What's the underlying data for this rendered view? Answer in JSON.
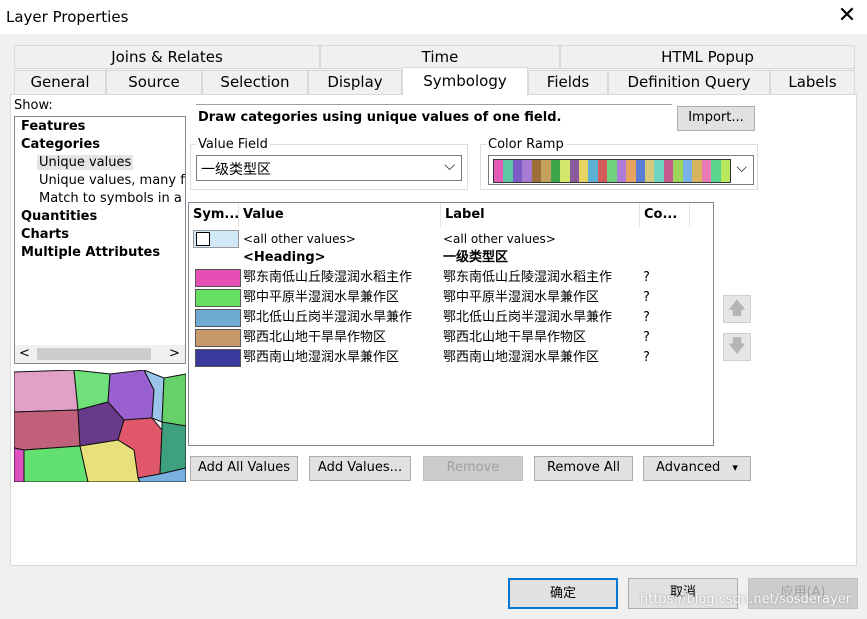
{
  "window": {
    "title": "Layer Properties",
    "close_glyph": "✕"
  },
  "tabs_top": [
    "Joins & Relates",
    "Time",
    "HTML Popup"
  ],
  "tabs_bottom": [
    "General",
    "Source",
    "Selection",
    "Display",
    "Symbology",
    "Fields",
    "Definition Query",
    "Labels"
  ],
  "active_tab": "Symbology",
  "show": {
    "label": "Show:",
    "items": [
      "Features",
      "Categories",
      "Unique values",
      "Unique values, many fiel",
      "Match to symbols in a sty",
      "Quantities",
      "Charts",
      "Multiple Attributes"
    ],
    "selected": "Unique values",
    "scroll_left": "<",
    "scroll_right": ">"
  },
  "symbology": {
    "description": "Draw categories using unique values of one field.",
    "import_label": "Import...",
    "value_field_label": "Value Field",
    "value_field_value": "一级类型区",
    "color_ramp_label": "Color Ramp",
    "color_ramp_colors": [
      "#e45bb8",
      "#5dc7a3",
      "#7c5cc4",
      "#a67bd2",
      "#9e6e3b",
      "#c4a25d",
      "#3fa54a",
      "#d3e76d",
      "#8a5b9c",
      "#e8d361",
      "#5bb0d6",
      "#d65b5b",
      "#72d17c",
      "#b07ad8",
      "#e8a361",
      "#5b7dd6",
      "#d8c97a",
      "#6fd6c4",
      "#c75b8e",
      "#9ed65b",
      "#7ab0e8",
      "#d6b45b",
      "#e87ab8",
      "#5bd68e",
      "#b8e85b"
    ],
    "combo_arrow": "⌵"
  },
  "grid": {
    "headers": [
      "Sym...",
      "Value",
      "Label",
      "Co..."
    ],
    "rows": [
      {
        "color": "#d1e8f7",
        "value": "<all other values>",
        "label": "<all other values>",
        "count": "",
        "bold": false,
        "swatch": "none-outline"
      },
      {
        "color": "",
        "value": "<Heading>",
        "label": "一级类型区",
        "count": "",
        "bold": true
      },
      {
        "color": "#e84fb5",
        "value": "鄂东南低山丘陵湿润水稻主作",
        "label": "鄂东南低山丘陵湿润水稻主作",
        "count": "?",
        "bold": false
      },
      {
        "color": "#66e060",
        "value": "鄂中平原半湿润水旱兼作区",
        "label": "鄂中平原半湿润水旱兼作区",
        "count": "?",
        "bold": false
      },
      {
        "color": "#6faad3",
        "value": "鄂北低山丘岗半湿润水旱兼作",
        "label": "鄂北低山丘岗半湿润水旱兼作",
        "count": "?",
        "bold": false
      },
      {
        "color": "#c8996b",
        "value": "鄂西北山地干旱旱作物区",
        "label": "鄂西北山地干旱旱作物区",
        "count": "?",
        "bold": false
      },
      {
        "color": "#3a3a9c",
        "value": "鄂西南山地湿润水旱兼作区",
        "label": "鄂西南山地湿润水旱兼作区",
        "count": "?",
        "bold": false
      }
    ]
  },
  "buttons": {
    "add_all": "Add All Values",
    "add_values": "Add Values...",
    "remove": "Remove",
    "remove_all": "Remove All",
    "advanced": "Advanced",
    "advanced_arrow": "▾",
    "up": "🡅",
    "down": "🡇"
  },
  "footer": {
    "ok": "确定",
    "cancel": "取消",
    "apply": "应用(A)",
    "watermark": "https://blog.csdn.net/sosderayer"
  }
}
